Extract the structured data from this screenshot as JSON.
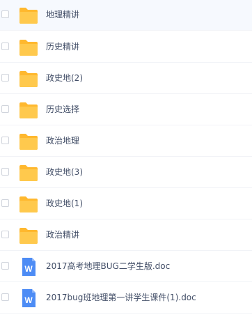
{
  "colors": {
    "folder": "#ffc94d",
    "folder_tab": "#ffb82e",
    "doc": "#4d8cf5",
    "text": "#424e67"
  },
  "files": [
    {
      "name": "地理精讲",
      "type": "folder",
      "icon": "folder-icon"
    },
    {
      "name": "历史精讲",
      "type": "folder",
      "icon": "folder-icon"
    },
    {
      "name": "政史地(2)",
      "type": "folder",
      "icon": "folder-icon"
    },
    {
      "name": "历史选择",
      "type": "folder",
      "icon": "folder-icon"
    },
    {
      "name": "政治地理",
      "type": "folder",
      "icon": "folder-icon"
    },
    {
      "name": "政史地(3)",
      "type": "folder",
      "icon": "folder-icon"
    },
    {
      "name": "政史地(1)",
      "type": "folder",
      "icon": "folder-icon"
    },
    {
      "name": "政治精讲",
      "type": "folder",
      "icon": "folder-icon"
    },
    {
      "name": "2017高考地理BUG二学生版.doc",
      "type": "doc",
      "icon": "word-doc-icon",
      "badge": "W"
    },
    {
      "name": "2017bug班地理第一讲学生课件(1).doc",
      "type": "doc",
      "icon": "word-doc-icon",
      "badge": "W"
    }
  ]
}
